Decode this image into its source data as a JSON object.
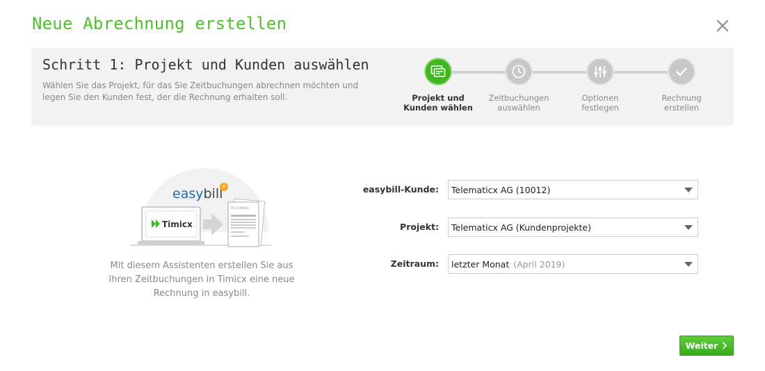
{
  "dialog": {
    "title": "Neue Abrechnung erstellen"
  },
  "step_header": {
    "title": "Schritt 1: Projekt und Kunden auswählen",
    "description": "Wählen Sie das Projekt, für das Sie Zeitbuchungen abrechnen möchten und legen Sie den Kunden fest, der die Rechnung erhalten soll."
  },
  "stepper": {
    "active_index": 0,
    "steps": [
      {
        "line1": "Projekt und",
        "line2": "Kunden wählen",
        "icon": "id-card-icon"
      },
      {
        "line1": "Zeitbuchungen",
        "line2": "auswählen",
        "icon": "clock-icon"
      },
      {
        "line1": "Optionen",
        "line2": "festlegen",
        "icon": "sliders-icon"
      },
      {
        "line1": "Rechnung",
        "line2": "erstellen",
        "icon": "checkmark-icon"
      }
    ]
  },
  "illustration": {
    "easybill_logo_text": "easybill",
    "timicx_logo_text": "Timicx",
    "invoice_doc_label": "RECHNUNG"
  },
  "intro": {
    "text": "Mit diesem Assistenten erstellen Sie aus Ihren Zeitbuchungen in Timicx eine neue Rechnung in easybill."
  },
  "form": {
    "customer": {
      "label": "easybill-Kunde:",
      "value": "Telematicx AG (10012)"
    },
    "project": {
      "label": "Projekt:",
      "value": "Telematicx AG (Kundenprojekte)"
    },
    "period": {
      "label": "Zeitraum:",
      "value": "letzter Monat",
      "hint": "(April 2019)"
    }
  },
  "actions": {
    "next_label": "Weiter"
  },
  "colors": {
    "brand_green": "#4fbf2c",
    "active_step": "#3fb81f",
    "inactive_step": "#c8c8c8"
  }
}
